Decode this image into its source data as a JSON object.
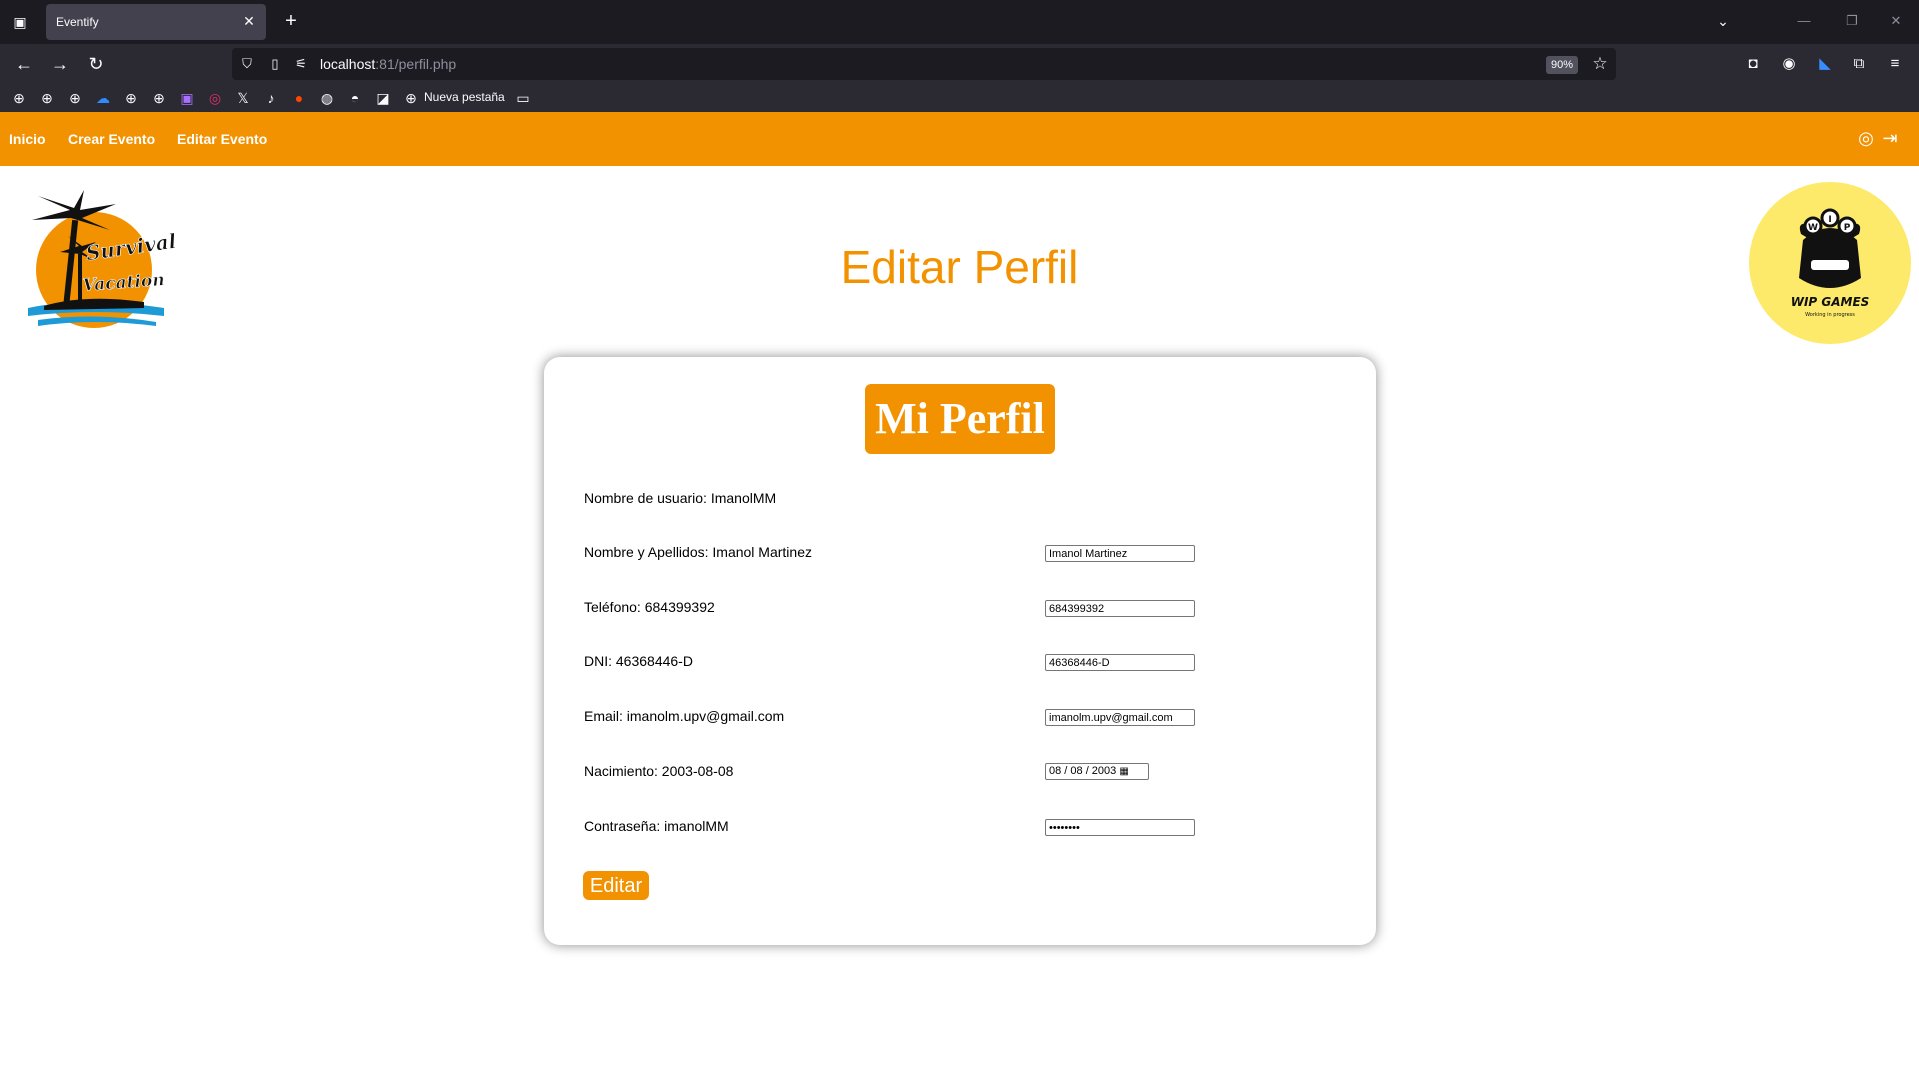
{
  "browser": {
    "tab_title": "Eventify",
    "url_host": "localhost",
    "url_path": ":81/perfil.php",
    "zoom": "90%",
    "bookmark_label": "Nueva pestaña"
  },
  "site_nav": {
    "links": [
      "Inicio",
      "Crear Evento",
      "Editar Evento"
    ]
  },
  "logos": {
    "left_text_1": "Survival",
    "left_text_2": "Vacation",
    "right_text_1": "WIP GAMES",
    "right_text_2": "Working in progress",
    "right_letters": [
      "W",
      "I",
      "P"
    ]
  },
  "page": {
    "title": "Editar Perfil",
    "card_title": "Mi Perfil",
    "fields": [
      {
        "label": "Nombre de usuario: ImanolMM"
      },
      {
        "label": "Nombre y Apellidos: Imanol Martinez",
        "value": "Imanol Martinez"
      },
      {
        "label": "Teléfono: 684399392",
        "value": "684399392"
      },
      {
        "label": "DNI: 46368446-D",
        "value": "46368446-D"
      },
      {
        "label": "Email: imanolm.upv@gmail.com",
        "value": "imanolm.upv@gmail.com"
      },
      {
        "label": "Nacimiento: 2003-08-08",
        "value": "08 / 08 / 2003"
      },
      {
        "label": "Contraseña: imanolMM",
        "value": "imanolMM"
      }
    ],
    "edit_button": "Editar"
  },
  "colors": {
    "accent": "#f39200",
    "logo_right_bg": "#fde96a"
  }
}
